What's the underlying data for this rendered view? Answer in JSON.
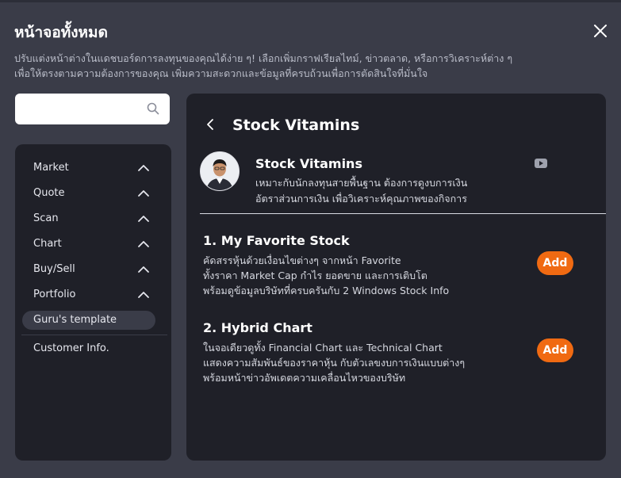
{
  "header": {
    "title": "หน้าจอทั้งหมด",
    "description_line1": "ปรับแต่งหน้าต่างในแดชบอร์ดการลงทุนของคุณได้ง่าย ๆ! เลือกเพิ่มกราฟเรียลไทม์, ข่าวตลาด, หรือการวิเคราะห์ต่าง ๆ",
    "description_line2": "เพื่อให้ตรงตามความต้องการของคุณ เพิ่มความสะดวกและข้อมูลที่ครบถ้วนเพื่อการตัดสินใจที่มั่นใจ"
  },
  "search": {
    "value": "",
    "placeholder": ""
  },
  "sidebar": {
    "items": [
      {
        "label": "Market"
      },
      {
        "label": "Quote"
      },
      {
        "label": "Scan"
      },
      {
        "label": "Chart"
      },
      {
        "label": "Buy/Sell"
      },
      {
        "label": "Portfolio"
      }
    ],
    "selected": {
      "label": "Guru's template"
    },
    "customer": {
      "label": "Customer Info."
    }
  },
  "main": {
    "title": "Stock Vitamins",
    "guru": {
      "name": "Stock Vitamins",
      "desc_line1": "เหมาะกับนักลงทุนสายพื้นฐาน ต้องการดูงบการเงิน",
      "desc_line2": "อัตราส่วนการเงิน เพื่อวิเคราะห์คุณภาพของกิจการ"
    },
    "templates": [
      {
        "title": "1. My Favorite Stock",
        "lines": [
          "คัดสรรหุ้นด้วยเงื่อนไขต่างๆ จากหน้า Favorite",
          "ทั้งราคา Market Cap กำไร ยอดขาย และการเติบโต",
          "พร้อมดูข้อมูลบริษัทที่ครบครันกับ 2 Windows Stock Info"
        ],
        "button": "Add"
      },
      {
        "title": "2. Hybrid Chart",
        "lines": [
          "ในจอเดียวดูทั้ง Financial Chart และ Technical Chart",
          "แสดงความสัมพันธ์ของราคาหุ้น กับตัวเลขงบการเงินแบบต่างๆ",
          "พร้อมหน้าข่าวอัพเดตความเคลื่อนไหวของบริษัท"
        ],
        "button": "Add"
      }
    ]
  },
  "colors": {
    "background": "#3a3c48",
    "panel": "#1f2028",
    "accent": "#f06a12"
  }
}
